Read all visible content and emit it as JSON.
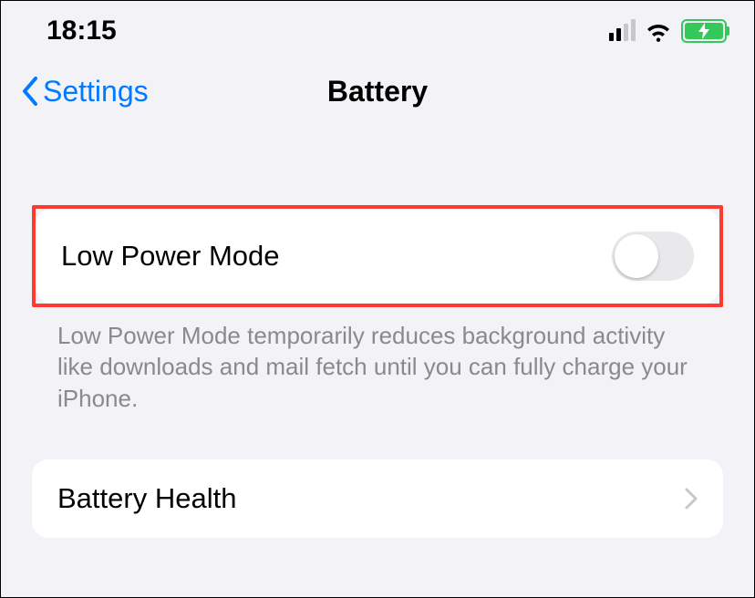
{
  "statusBar": {
    "time": "18:15"
  },
  "nav": {
    "backLabel": "Settings",
    "title": "Battery"
  },
  "lowPowerMode": {
    "label": "Low Power Mode",
    "description": "Low Power Mode temporarily reduces background activity like downloads and mail fetch until you can fully charge your iPhone.",
    "enabled": false
  },
  "batteryHealth": {
    "label": "Battery Health"
  }
}
